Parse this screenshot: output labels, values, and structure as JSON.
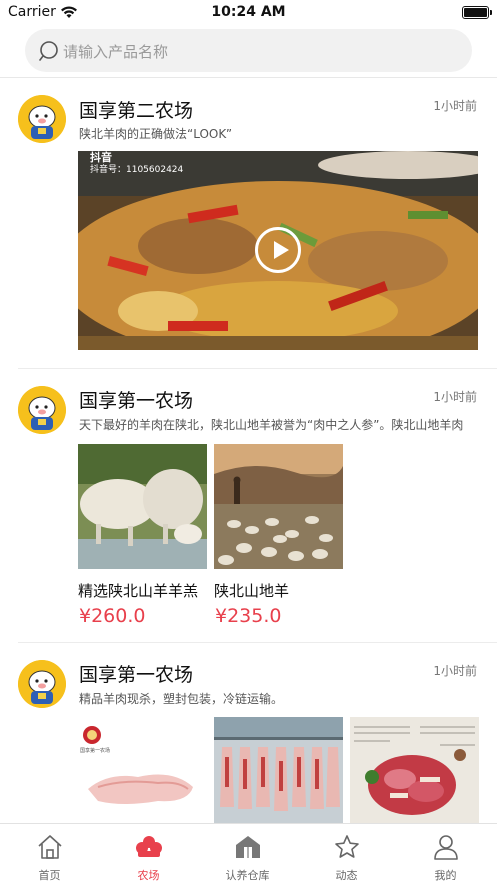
{
  "status_bar": {
    "carrier": "Carrier",
    "time": "10:24 AM"
  },
  "search": {
    "placeholder": "请输入产品名称"
  },
  "posts": [
    {
      "farm_name": "国享第二农场",
      "time": "1小时前",
      "description": "陕北羊肉的正确做法“LOOK”",
      "video": {
        "watermark_app": "抖音",
        "watermark_id": "抖音号：1105602424"
      }
    },
    {
      "farm_name": "国享第一农场",
      "time": "1小时前",
      "description": "天下最好的羊肉在陕北，陕北山地羊被誉为“肉中之人参”。陕北山地羊肉",
      "products": [
        {
          "name": "精选陕北山羊羊羔",
          "price": "¥260.0"
        },
        {
          "name": "陕北山地羊",
          "price": "¥235.0"
        }
      ]
    },
    {
      "farm_name": "国享第一农场",
      "time": "1小时前",
      "description": "精品羊肉现杀，塑封包装，冷链运输。",
      "images": [
        {
          "caption": "国享第一农场"
        },
        {
          "caption": ""
        },
        {
          "caption": ""
        }
      ]
    }
  ],
  "tabbar": {
    "active_color": "#e8404c",
    "tabs": [
      {
        "label": "首页",
        "icon": "home-icon"
      },
      {
        "label": "农场",
        "icon": "farm-icon",
        "active": true
      },
      {
        "label": "认养仓库",
        "icon": "warehouse-icon"
      },
      {
        "label": "动态",
        "icon": "star-icon"
      },
      {
        "label": "我的",
        "icon": "profile-icon"
      }
    ]
  }
}
